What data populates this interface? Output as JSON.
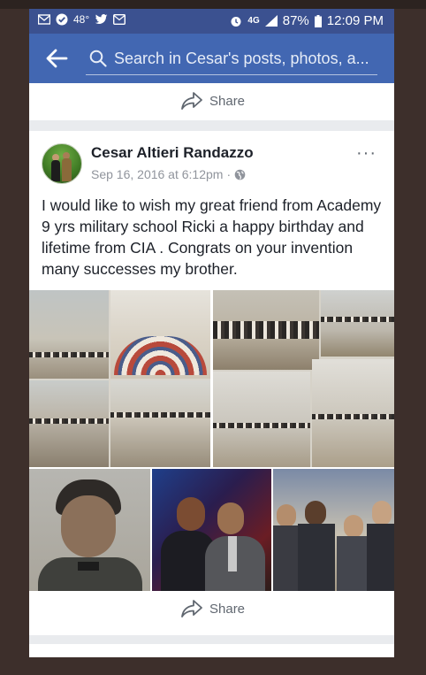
{
  "status_bar": {
    "temperature": "48°",
    "network": "4G",
    "battery": "87%",
    "time": "12:09 PM",
    "icons": [
      "mail-icon",
      "check-circle-icon",
      "twitter-icon",
      "message-icon",
      "alarm-icon",
      "signal-icon",
      "battery-icon"
    ]
  },
  "search": {
    "placeholder": "Search in Cesar's posts, photos, a..."
  },
  "actions": {
    "share_label": "Share"
  },
  "post": {
    "author": "Cesar Altieri Randazzo",
    "timestamp": "Sep 16, 2016 at 6:12pm",
    "separator": "·",
    "more": "···",
    "text": "I would like to wish my great friend from Academy 9 yrs military school Ricki a happy birthday and lifetime from CIA . Congrats on your invention many successes my brother."
  },
  "colors": {
    "status_bar": "#3b5190",
    "header": "#4267b2",
    "page_bg": "#e9ebee",
    "card_bg": "#ffffff",
    "text": "#1d2129",
    "muted": "#90949c"
  }
}
